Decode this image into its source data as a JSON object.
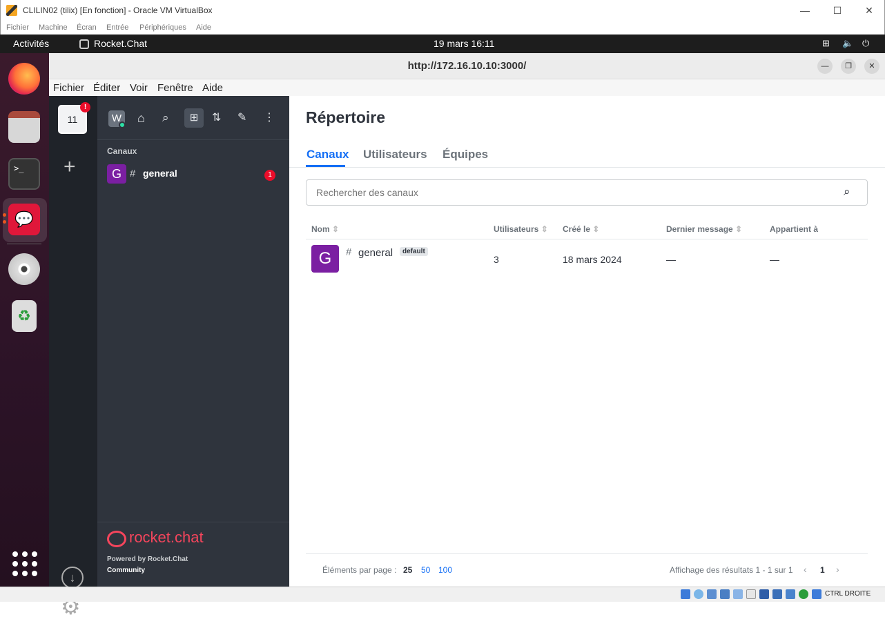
{
  "vbox": {
    "title": "CLILIN02 (tilix) [En fonction] - Oracle VM VirtualBox",
    "menu": [
      "Fichier",
      "Machine",
      "Écran",
      "Entrée",
      "Périphériques",
      "Aide"
    ],
    "status_text": "CTRL DROITE"
  },
  "gnome": {
    "activities": "Activités",
    "app_name": "Rocket.Chat",
    "clock": "19 mars  16:11"
  },
  "browser": {
    "url": "http://172.16.10.10:3000/",
    "menu": [
      "Fichier",
      "Éditer",
      "Voir",
      "Fenêtre",
      "Aide"
    ]
  },
  "rail": {
    "server_label": "11",
    "badge": "!"
  },
  "sidebar": {
    "avatar_letter": "W",
    "section_title": "Canaux",
    "channel_avatar": "G",
    "channel_name": "general",
    "channel_unread": "1",
    "brand": "rocket.chat",
    "powered": "Powered by Rocket.Chat",
    "edition": "Community"
  },
  "directory": {
    "title": "Répertoire",
    "tabs": [
      "Canaux",
      "Utilisateurs",
      "Équipes"
    ],
    "active_tab": "Canaux",
    "search_placeholder": "Rechercher des canaux",
    "columns": [
      "Nom",
      "Utilisateurs",
      "Créé le",
      "Dernier message",
      "Appartient à"
    ],
    "rows": [
      {
        "avatar": "G",
        "name": "general",
        "tag": "default",
        "users": "3",
        "created": "18 mars 2024",
        "last_message": "—",
        "belongs": "—"
      }
    ],
    "per_page_label": "Éléments par page :",
    "per_page": [
      "25",
      "50",
      "100"
    ],
    "results": "Affichage des résultats 1 - 1 sur 1",
    "page": "1"
  },
  "colors": {
    "accent": "#156ff5",
    "brand_red": "#f5455c",
    "purple_avatar": "#7b1fa2",
    "sidebar_bg": "#2f343d",
    "rail_bg": "#1f2329"
  }
}
